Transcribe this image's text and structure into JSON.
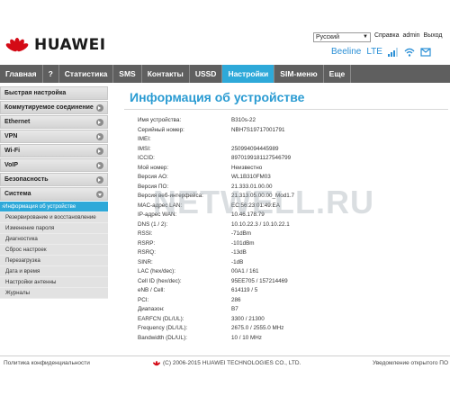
{
  "brand": {
    "name": "HUAWEI",
    "accent": "#2ea9d9",
    "logo_red": "#d40a16"
  },
  "top": {
    "language": "Русский",
    "help": "Справка",
    "user": "admin",
    "logout": "Выход",
    "operator": "Beeline",
    "network_type": "LTE"
  },
  "nav": {
    "items": [
      {
        "label": "Главная"
      },
      {
        "label": "?"
      },
      {
        "label": "Статистика"
      },
      {
        "label": "SMS"
      },
      {
        "label": "Контакты"
      },
      {
        "label": "USSD"
      },
      {
        "label": "Настройки"
      },
      {
        "label": "SIM-меню"
      },
      {
        "label": "Еще"
      }
    ],
    "active_index": 6
  },
  "sidebar": {
    "items": [
      {
        "label": "Быстрая настройка"
      },
      {
        "label": "Коммутируемое соединение"
      },
      {
        "label": "Ethernet"
      },
      {
        "label": "VPN"
      },
      {
        "label": "Wi-Fi"
      },
      {
        "label": "VoIP"
      },
      {
        "label": "Безопасность"
      },
      {
        "label": "Система"
      }
    ],
    "system_sub": [
      {
        "label": "›Информация об устройстве"
      },
      {
        "label": "Резервирование и восстановление"
      },
      {
        "label": "Изменение пароля"
      },
      {
        "label": "Диагностика"
      },
      {
        "label": "Сброс настроек"
      },
      {
        "label": "Перезагрузка"
      },
      {
        "label": "Дата и время"
      },
      {
        "label": "Настройки антенны"
      },
      {
        "label": "Журналы"
      }
    ]
  },
  "main": {
    "title": "Информация об устройстве",
    "rows": [
      {
        "key": "Имя устройства:",
        "value": "B310s-22"
      },
      {
        "key": "Серийный номер:",
        "value": "NBH7S19717001791"
      },
      {
        "key": "IMEI:",
        "value": ""
      },
      {
        "key": "IMSI:",
        "value": "250994094445989"
      },
      {
        "key": "ICCID:",
        "value": "8970199181127546799"
      },
      {
        "key": "Мой номер:",
        "value": "Неизвестно"
      },
      {
        "key": "Версия АО:",
        "value": "WL1B310FM03"
      },
      {
        "key": "Версия ПО:",
        "value": "21.333.01.00.00"
      },
      {
        "key": "Версия веб-интерфейса:",
        "value": "21.313.05.00.00_Mod1.7"
      },
      {
        "key": "MAC-адрес LAN:",
        "value": "EC:56:23:01:49:EA"
      },
      {
        "key": "IP-адрес WAN:",
        "value": "10.46.178.79"
      },
      {
        "key": "DNS (1 / 2):",
        "value": "10.10.22.3 / 10.10.22.1"
      },
      {
        "key": "RSSI:",
        "value": "-71dBm"
      },
      {
        "key": "RSRP:",
        "value": "-101dBm"
      },
      {
        "key": "RSRQ:",
        "value": "-13dB"
      },
      {
        "key": "SINR:",
        "value": "-1dB"
      },
      {
        "key": "LAC (hex/dec):",
        "value": "00A1 / 161"
      },
      {
        "key": "Cell ID (hex/dec):",
        "value": "95EE705 / 157214469"
      },
      {
        "key": "eNB / Cell:",
        "value": "614119 / 5"
      },
      {
        "key": "PCI:",
        "value": "286"
      },
      {
        "key": "Диапазон:",
        "value": "B7"
      },
      {
        "key": "EARFCN (DL/UL):",
        "value": "3300 / 21300"
      },
      {
        "key": "Frequency (DL/UL):",
        "value": "2675.0 / 2555.0 MHz"
      },
      {
        "key": "Bandwidth (DL/UL):",
        "value": "10 / 10 MHz"
      }
    ]
  },
  "watermark": "NETWELL.RU",
  "footer": {
    "privacy": "Политика конфиденциальности",
    "copyright": "(C) 2006-2015 HUAWEI TECHNOLOGIES CO., LTD.",
    "notice": "Уведомление открытого ПО"
  }
}
